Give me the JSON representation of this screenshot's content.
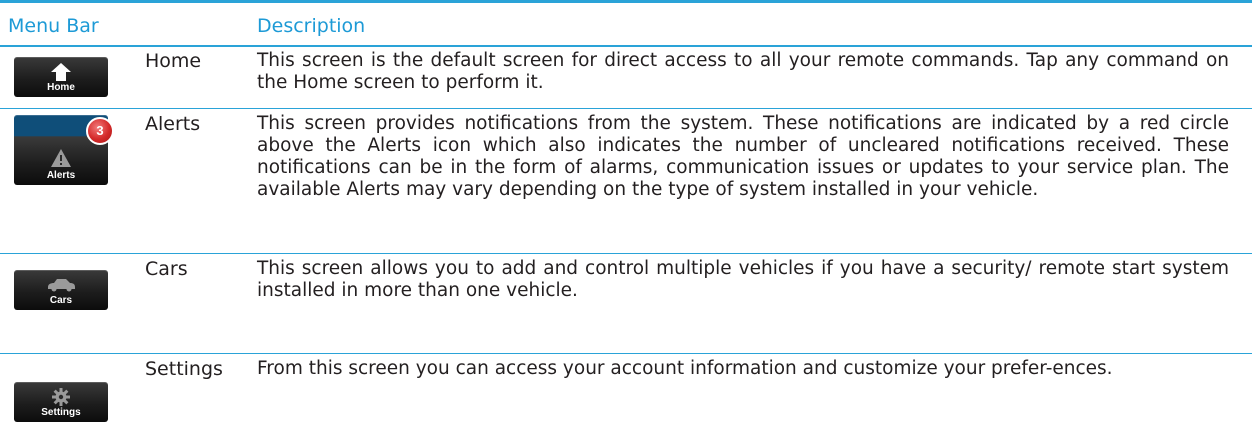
{
  "header": {
    "menu_bar_label": "Menu Bar",
    "description_label": "Description"
  },
  "rows": [
    {
      "button_label": "Home",
      "icon": "home-icon",
      "name": "Home",
      "description": "This screen is the default screen for direct access to all your remote commands. Tap any command on the Home screen to perform it."
    },
    {
      "button_label": "Alerts",
      "icon": "warning-icon",
      "badge": "3",
      "name": "Alerts",
      "description": "This screen provides notifications from the system. These notifications are indicated by a red circle above the Alerts icon which also indicates the number of uncleared notifications received. These notifications can be in the form of alarms, communication issues or updates to your service plan. The available Alerts may vary depending on the type of system installed in your vehicle."
    },
    {
      "button_label": "Cars",
      "icon": "car-icon",
      "name": "Cars",
      "description": "This screen allows you to add and control multiple vehicles if you have a security/ remote start system installed in more than one vehicle."
    },
    {
      "button_label": "Settings",
      "icon": "gear-icon",
      "name": "Settings",
      "description": "From this screen you can access your account information and customize your prefer-ences."
    }
  ],
  "colors": {
    "accent": "#2aa3d8",
    "header_text": "#1d9ad6",
    "body_text": "#231f20",
    "badge": "#d42a2a"
  }
}
